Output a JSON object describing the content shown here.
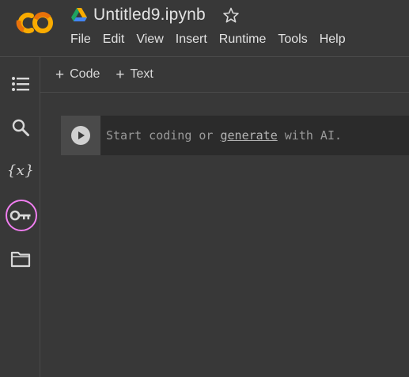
{
  "header": {
    "title": "Untitled9.ipynb",
    "menu": [
      "File",
      "Edit",
      "View",
      "Insert",
      "Runtime",
      "Tools",
      "Help"
    ]
  },
  "toolbar": {
    "code_label": "Code",
    "text_label": "Text"
  },
  "sidebar": {
    "items": [
      {
        "name": "table-of-contents",
        "icon": "list-icon"
      },
      {
        "name": "find",
        "icon": "search-icon"
      },
      {
        "name": "variables",
        "icon": "variables-icon",
        "glyph": "{x}"
      },
      {
        "name": "secrets",
        "icon": "key-icon",
        "highlighted": true
      },
      {
        "name": "files",
        "icon": "folder-icon"
      }
    ]
  },
  "cell": {
    "placeholder_before": "Start coding or ",
    "placeholder_link": "generate",
    "placeholder_after": " with AI."
  },
  "colors": {
    "background": "#383838",
    "cell_background": "#2b2b2b",
    "highlight_ring": "#f07ef0",
    "logo_orange": "#f9ab00",
    "logo_dark_orange": "#e8710a"
  }
}
